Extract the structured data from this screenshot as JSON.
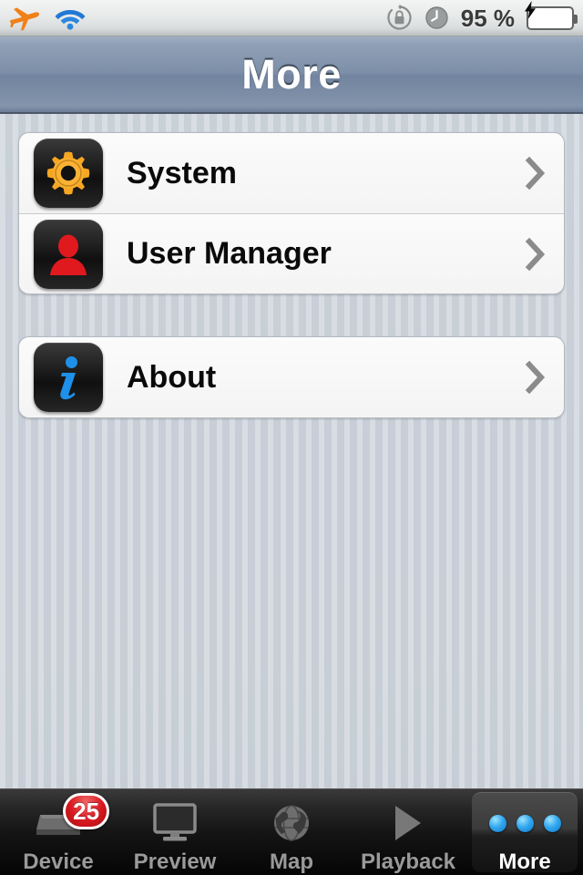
{
  "status_bar": {
    "airplane_icon": "airplane-icon",
    "wifi_icon": "wifi-icon",
    "rotation_lock_icon": "rotation-lock-icon",
    "alarm_icon": "alarm-clock-icon",
    "battery_percent": "95 %",
    "battery_icon": "battery-charging-icon",
    "battery_color": "#45c117"
  },
  "navbar": {
    "title": "More"
  },
  "sections": [
    {
      "rows": [
        {
          "label": "System",
          "icon": "gear-icon",
          "icon_color": "#f5a623",
          "accessory": "chevron-right-icon"
        },
        {
          "label": "User Manager",
          "icon": "user-icon",
          "icon_color": "#e0191f",
          "accessory": "chevron-right-icon"
        }
      ]
    },
    {
      "rows": [
        {
          "label": "About",
          "icon": "info-icon",
          "icon_color": "#1e90e8",
          "accessory": "chevron-right-icon"
        }
      ]
    }
  ],
  "tabbar": {
    "tabs": [
      {
        "label": "Device",
        "icon": "device-icon",
        "badge": "25",
        "selected": false
      },
      {
        "label": "Preview",
        "icon": "monitor-icon",
        "badge": null,
        "selected": false
      },
      {
        "label": "Map",
        "icon": "globe-icon",
        "badge": null,
        "selected": false
      },
      {
        "label": "Playback",
        "icon": "play-icon",
        "badge": null,
        "selected": false
      },
      {
        "label": "More",
        "icon": "more-dots-icon",
        "badge": null,
        "selected": true
      }
    ]
  },
  "colors": {
    "background": "#c6cdd6",
    "navbar": "#7d8fa8",
    "badge": "#d81920",
    "accent_blue": "#34a9ef"
  }
}
